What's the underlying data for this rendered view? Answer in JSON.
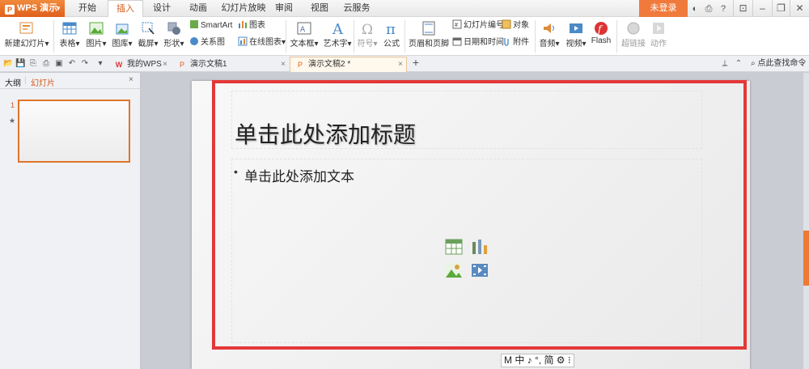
{
  "app": {
    "name": "WPS 演示",
    "logo": "P"
  },
  "menu": {
    "tabs": [
      "开始",
      "插入",
      "设计",
      "动画",
      "幻灯片放映",
      "审阅",
      "视图",
      "云服务"
    ],
    "active": "插入",
    "login": "未登录"
  },
  "ribbon": {
    "new_slide": "新建幻灯片",
    "table": "表格",
    "picture": "图片",
    "gallery": "图库",
    "screenshot": "截屏",
    "shape": "形状",
    "smartart": "SmartArt",
    "relation": "关系图",
    "chart": "图表",
    "online_chart": "在线图表",
    "textbox": "文本框",
    "wordart": "艺术字",
    "symbol": "符号",
    "formula": "公式",
    "header_footer": "页眉和页脚",
    "slide_number": "幻灯片编号",
    "object": "对象",
    "datetime": "日期和时间",
    "attachment": "附件",
    "audio": "音频",
    "video": "视频",
    "flash": "Flash",
    "hyperlink": "超链接",
    "action": "动作"
  },
  "tabs": [
    {
      "label": "我的WPS",
      "icon": "W"
    },
    {
      "label": "演示文稿1",
      "icon": "P"
    },
    {
      "label": "演示文稿2 *",
      "icon": "P",
      "active": true
    }
  ],
  "search": {
    "label": "点此查找命令"
  },
  "panel": {
    "outline": "大纲",
    "slides": "幻灯片",
    "slide_number": "1",
    "star": "★"
  },
  "slide": {
    "title_placeholder": "单击此处添加标题",
    "body_placeholder": "单击此处添加文本",
    "bullet": "•"
  },
  "ime": {
    "text": "M 中 ♪ °, 简 ⚙ ⁝"
  },
  "colors": {
    "accent": "#e0601c",
    "highlight": "#e43838"
  }
}
